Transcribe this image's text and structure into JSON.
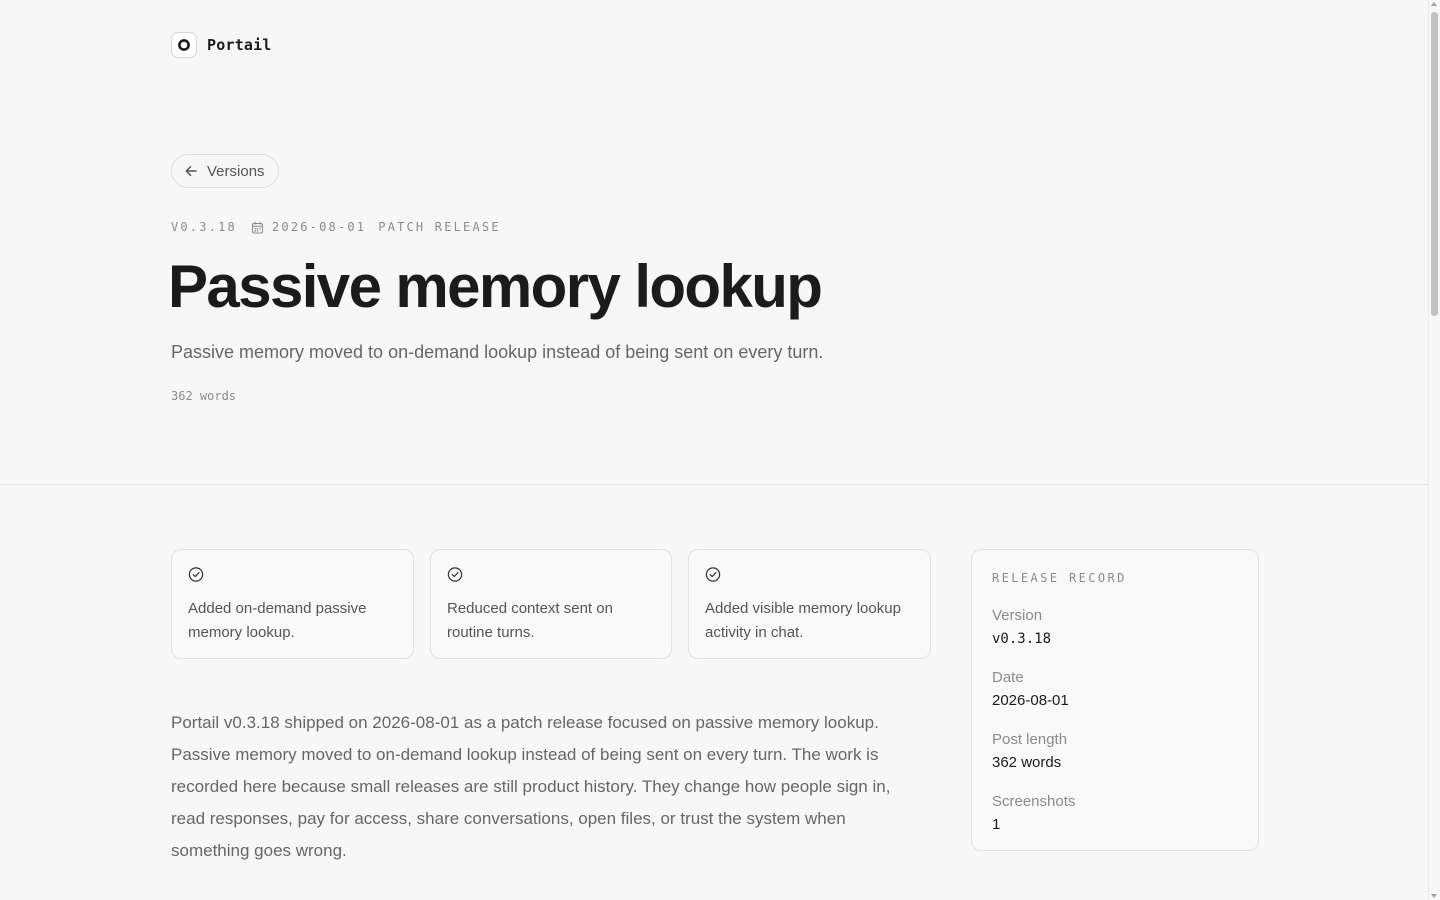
{
  "brand": {
    "name": "Portail",
    "logo_icon": "portail-logo-icon"
  },
  "nav": {
    "back_label": "Versions",
    "back_icon": "arrow-left-icon"
  },
  "release": {
    "version_tag": "V0.3.18",
    "date": "2026-08-01",
    "type": "PATCH RELEASE",
    "title": "Passive memory lookup",
    "summary": "Passive memory moved to on-demand lookup instead of being sent on every turn.",
    "word_count": "362 words"
  },
  "highlights": [
    {
      "icon": "check-circle-icon",
      "text": "Added on-demand passive memory lookup."
    },
    {
      "icon": "check-circle-icon",
      "text": "Reduced context sent on routine turns."
    },
    {
      "icon": "check-circle-icon",
      "text": "Added visible memory lookup activity in chat."
    }
  ],
  "body": "Portail v0.3.18 shipped on 2026-08-01 as a patch release focused on passive memory lookup. Passive memory moved to on-demand lookup instead of being sent on every turn. The work is recorded here because small releases are still product history. They change how people sign in, read responses, pay for access, share conversations, open files, or trust the system when something goes wrong.",
  "record": {
    "heading": "RELEASE RECORD",
    "rows": [
      {
        "label": "Version",
        "value": "v0.3.18"
      },
      {
        "label": "Date",
        "value": "2026-08-01"
      },
      {
        "label": "Post length",
        "value": "362 words"
      },
      {
        "label": "Screenshots",
        "value": "1"
      }
    ]
  }
}
